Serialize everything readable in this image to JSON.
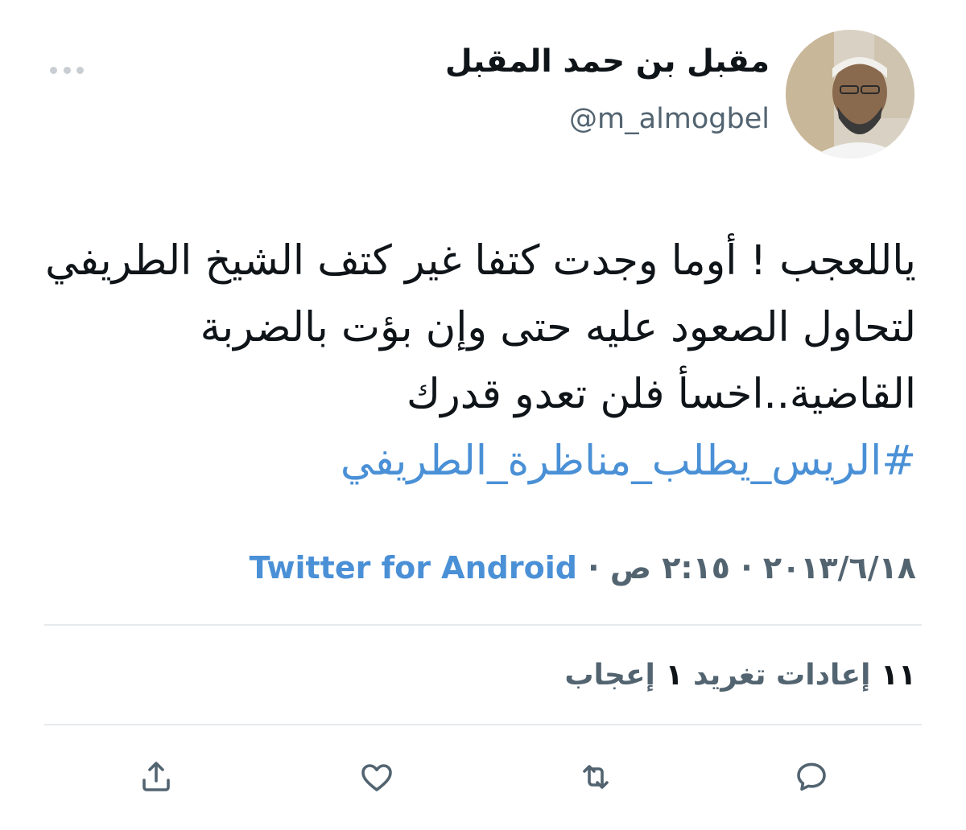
{
  "author": {
    "name": "مقبل بن حمد المقبل",
    "handle": "@m_almogbel"
  },
  "tweet": {
    "text": "ياللعجب ! أوما وجدت كتفا غير كتف الشيخ الطريفي لتحاول الصعود عليه حتى وإن بؤت بالضربة القاضية..اخسأ فلن تعدو قدرك",
    "hashtag": "#الريس_يطلب_مناظرة_الطريفي"
  },
  "meta": {
    "date": "٢٠١٣/٦/١٨",
    "separator": "·",
    "time": "٢:١٥ ص",
    "source": "Twitter for Android"
  },
  "stats": {
    "retweets_count": "١١",
    "retweets_label": "إعادات تغريد",
    "likes_count": "١",
    "likes_label": "إعجاب"
  },
  "actions": {
    "reply_icon": "reply-icon",
    "retweet_icon": "retweet-icon",
    "like_icon": "heart-icon",
    "share_icon": "share-icon"
  },
  "colors": {
    "link": "#4a90d6",
    "secondary_text": "#536471",
    "primary_text": "#0f1419",
    "divider": "#e7eaec"
  }
}
